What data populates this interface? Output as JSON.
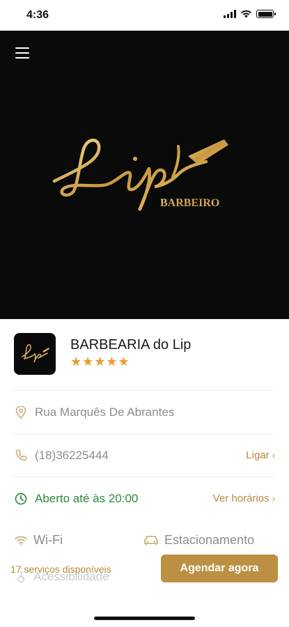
{
  "status_bar": {
    "time": "4:36"
  },
  "hero": {
    "logo_script": "Lip",
    "logo_subtitle": "BARBEIRO"
  },
  "shop": {
    "name": "BARBEARIA do Lip",
    "stars": "★★★★★",
    "rating": 5,
    "logo_script": "Lip"
  },
  "address": {
    "text": "Rua Marquês De Abrantes"
  },
  "phone": {
    "text": "(18)36225444",
    "action": "Ligar"
  },
  "hours": {
    "text": "Aberto até às 20:00",
    "action": "Ver horários"
  },
  "amenities": [
    {
      "label": "Wi-Fi",
      "icon": "wifi-icon"
    },
    {
      "label": "Estacionamento",
      "icon": "car-icon"
    },
    {
      "label": "Acessibilidade",
      "icon": "accessibility-icon"
    }
  ],
  "footer": {
    "services_count": "17 serviços disponíveis",
    "book_label": "Agendar agora"
  },
  "colors": {
    "accent": "#bc9043",
    "stars": "#e79b2f",
    "open": "#2a8a3a",
    "hero_bg": "#0a0a0a"
  }
}
